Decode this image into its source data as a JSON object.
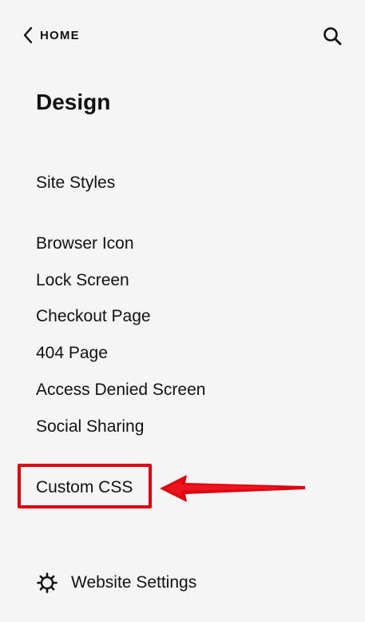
{
  "header": {
    "back_label": "HOME",
    "back_icon": "chevron-left-icon",
    "search_icon": "search-icon"
  },
  "page": {
    "title": "Design"
  },
  "menu": {
    "site_styles": "Site Styles",
    "items": [
      "Browser Icon",
      "Lock Screen",
      "Checkout Page",
      "404 Page",
      "Access Denied Screen",
      "Social Sharing"
    ],
    "custom_css": "Custom CSS"
  },
  "footer": {
    "settings_label": "Website Settings",
    "settings_icon": "gear-icon"
  },
  "colors": {
    "background": "#f5f5f5",
    "text": "#111111",
    "annotation": "#e0000f"
  }
}
